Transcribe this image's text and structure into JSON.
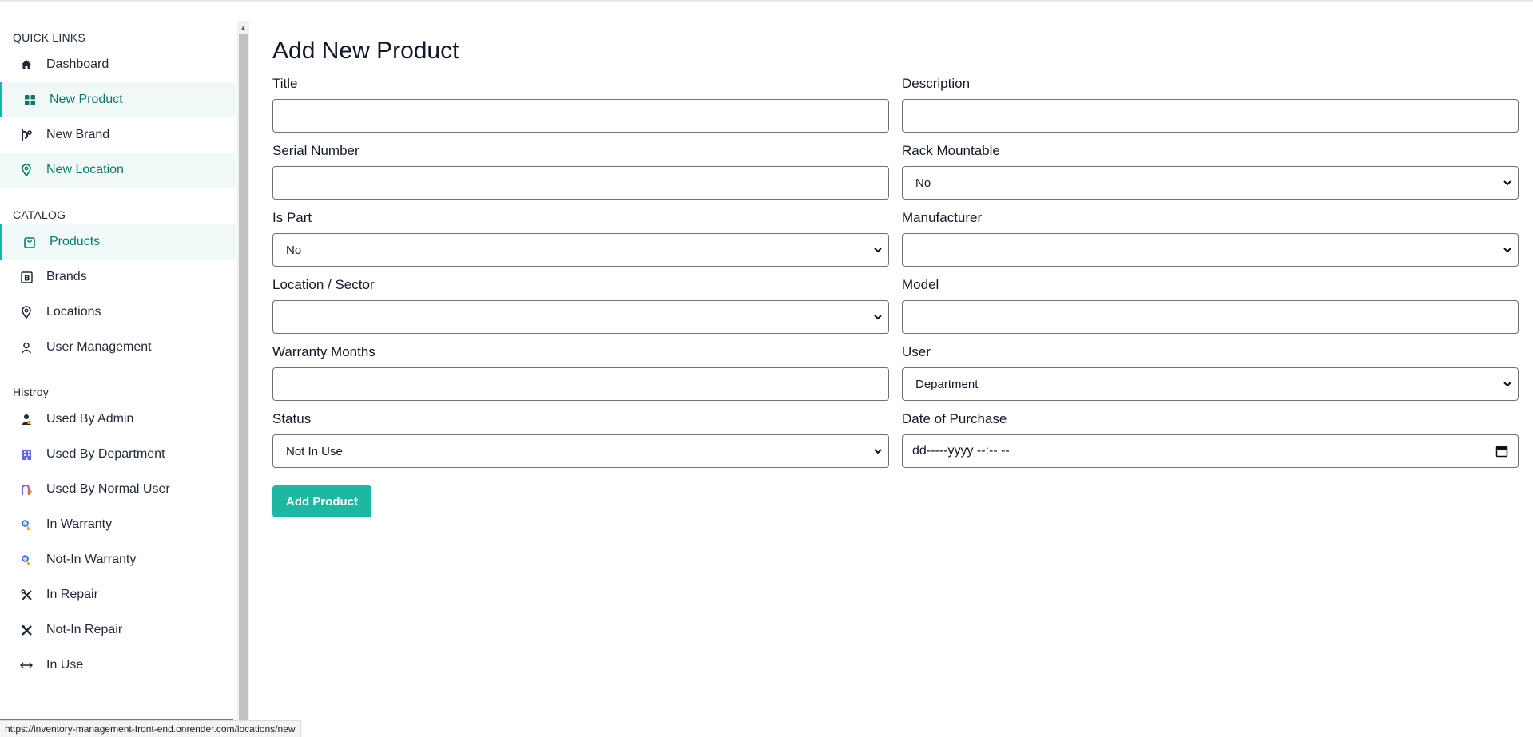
{
  "sidebar": {
    "quick_links_title": "QUICK LINKS",
    "quick_links": [
      {
        "label": "Dashboard",
        "icon": "home-icon"
      },
      {
        "label": "New Product",
        "icon": "grid-icon"
      },
      {
        "label": "New Brand",
        "icon": "brand-icon"
      },
      {
        "label": "New Location",
        "icon": "location-pin-icon"
      }
    ],
    "catalog_title": "CATALOG",
    "catalog": [
      {
        "label": "Products",
        "icon": "shopping-bag-icon"
      },
      {
        "label": "Brands",
        "icon": "brand-b-icon"
      },
      {
        "label": "Locations",
        "icon": "location-pin-icon"
      },
      {
        "label": "User Management",
        "icon": "user-icon"
      }
    ],
    "history_title": "Histroy",
    "history": [
      {
        "label": "Used By Admin",
        "icon": "admin-user-icon"
      },
      {
        "label": "Used By Department",
        "icon": "building-icon"
      },
      {
        "label": "Used By Normal User",
        "icon": "normal-user-icon"
      },
      {
        "label": "In Warranty",
        "icon": "warranty-icon"
      },
      {
        "label": "Not-In Warranty",
        "icon": "warranty-icon"
      },
      {
        "label": "In Repair",
        "icon": "tools-icon"
      },
      {
        "label": "Not-In Repair",
        "icon": "tools-icon"
      },
      {
        "label": "In Use",
        "icon": "arrows-horizontal-icon"
      }
    ]
  },
  "main": {
    "title": "Add New Product",
    "fields": {
      "title": {
        "label": "Title",
        "value": ""
      },
      "description": {
        "label": "Description",
        "value": ""
      },
      "serial_number": {
        "label": "Serial Number",
        "value": ""
      },
      "rack_mountable": {
        "label": "Rack Mountable",
        "value": "No"
      },
      "is_part": {
        "label": "Is Part",
        "value": "No"
      },
      "manufacturer": {
        "label": "Manufacturer",
        "value": ""
      },
      "location_sector": {
        "label": "Location / Sector",
        "value": ""
      },
      "model": {
        "label": "Model",
        "value": ""
      },
      "warranty_months": {
        "label": "Warranty Months",
        "value": ""
      },
      "user": {
        "label": "User",
        "value": "Department"
      },
      "status": {
        "label": "Status",
        "value": "Not In Use"
      },
      "date_of_purchase": {
        "label": "Date of Purchase",
        "placeholder": "dd-----yyyy --:-- --"
      }
    },
    "submit_label": "Add Product"
  },
  "status_bar": {
    "url": "https://inventory-management-front-end.onrender.com/locations/new"
  },
  "colors": {
    "accent": "#1db8a1",
    "active_text": "#0f766e",
    "active_bg": "#f0f9f7"
  }
}
